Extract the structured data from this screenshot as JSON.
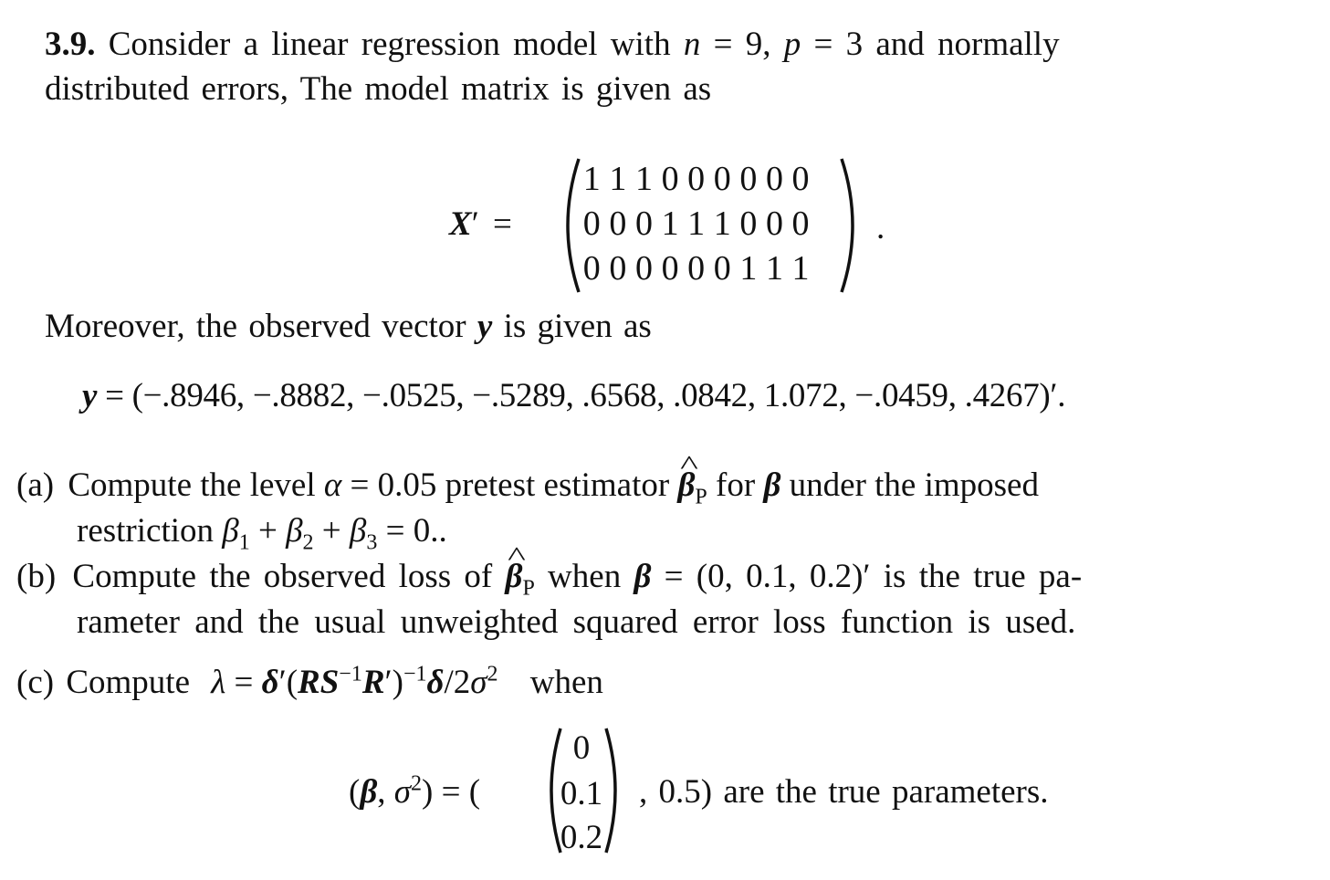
{
  "problem": {
    "number": "3.9.",
    "intro_line1_a": "Consider a linear regression model with ",
    "n_symbol": "n",
    "eq1": " = 9, ",
    "p_symbol": "p",
    "eq2": " = 3 and normally",
    "intro_line2": "distributed errors, The model matrix is given as"
  },
  "matrix_X": {
    "label": "X",
    "prime": "′",
    "equals": "=",
    "rows": [
      [
        "1",
        "1",
        "1",
        "0",
        "0",
        "0",
        "0",
        "0",
        "0"
      ],
      [
        "0",
        "0",
        "0",
        "1",
        "1",
        "1",
        "0",
        "0",
        "0"
      ],
      [
        "0",
        "0",
        "0",
        "0",
        "0",
        "0",
        "1",
        "1",
        "1"
      ]
    ],
    "trailing": "."
  },
  "vector_y": {
    "intro": "Moreover, the observed vector ",
    "symbol": "y",
    "intro_end": " is given as",
    "equation_lhs": "y",
    "equation_body": " = (−.8946, −.8882, −.0525, −.5289, .6568, .0842, 1.072, −.0459, .4267)′.",
    "values": [
      -0.8946,
      -0.8882,
      -0.0525,
      -0.5289,
      0.6568,
      0.0842,
      1.072,
      -0.0459,
      0.4267
    ]
  },
  "parts": {
    "a": {
      "label": "(a)",
      "line1_a": "Compute the level ",
      "alpha": "α",
      "line1_b": " = 0.05 pretest estimator ",
      "beta_hat": "β",
      "sub_P": "P",
      "line1_c": " for ",
      "beta": "β",
      "line1_d": " under the imposed",
      "line2_a": "restriction ",
      "b1": "β",
      "s1": "1",
      "plus1": " + ",
      "b2": "β",
      "s2": "2",
      "plus2": " + ",
      "b3": "β",
      "s3": "3",
      "line2_end": " = 0.."
    },
    "b": {
      "label": "(b)",
      "line1_a": "Compute the observed loss of ",
      "beta_hat": "β",
      "sub_P": "P",
      "line1_b": " when ",
      "beta": "β",
      "line1_c": " = (0, 0.1, 0.2)′ is the true pa-",
      "line2": "rameter and the usual unweighted squared error loss function is used."
    },
    "c": {
      "label": "(c)",
      "compute": "Compute",
      "lambda": "λ",
      "eq": " = ",
      "delta": "δ",
      "prime": "′",
      "open": "(",
      "R": "R",
      "S": "S",
      "inv": "−1",
      "R2": "R",
      "close": ")",
      "delta2": "δ",
      "slash": "/2",
      "sigma": "σ",
      "sq": "2",
      "when": "when",
      "lhs_open": "(",
      "lhs_beta": "β",
      "lhs_comma": ", ",
      "lhs_sigma": "σ",
      "lhs_sq": "2",
      "lhs_close": ") = (",
      "beta_vector": [
        "0",
        "0.1",
        "0.2"
      ],
      "tail": ", 0.5) are the true parameters."
    }
  }
}
